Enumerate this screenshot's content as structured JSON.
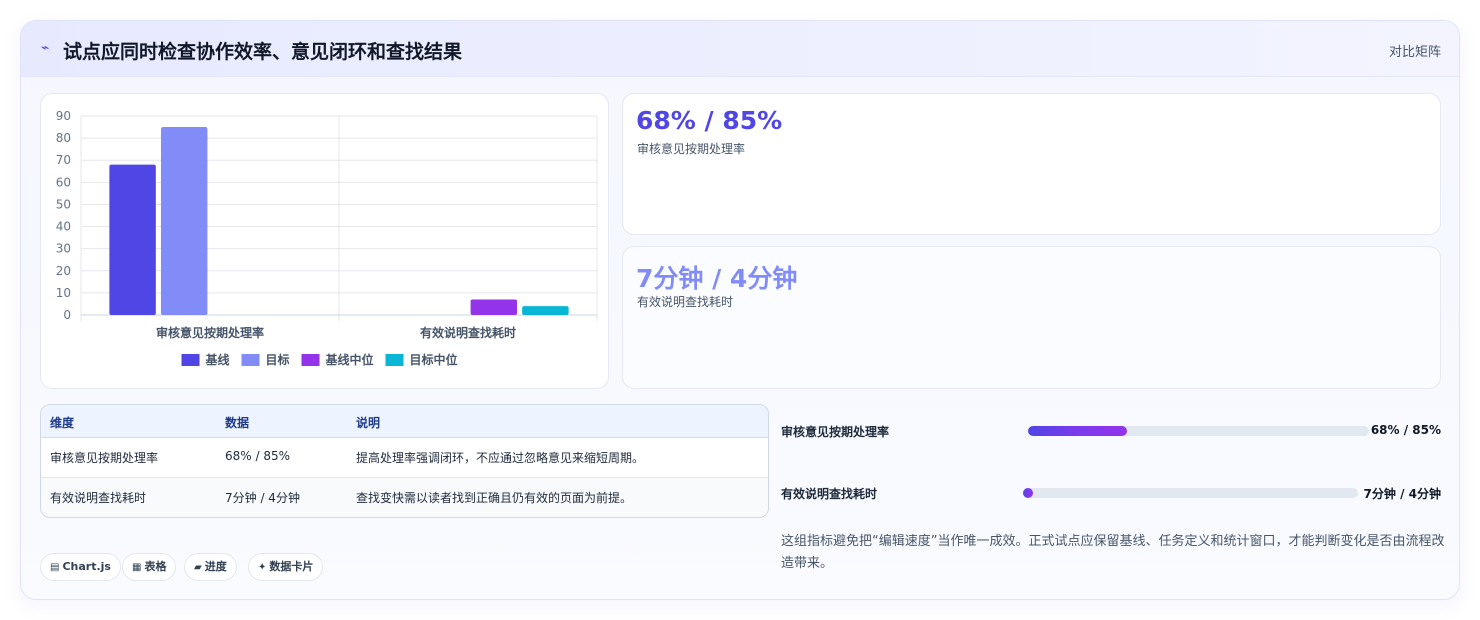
{
  "header": {
    "icon": "trend-icon",
    "title": "试点应同时检查协作效率、意见闭环和查找结果",
    "tag": "对比矩阵"
  },
  "chart_data": {
    "type": "bar",
    "categories": [
      "审核意见按期处理率",
      "有效说明查找耗时"
    ],
    "series": [
      {
        "name": "基线",
        "values": [
          68,
          null
        ],
        "color": "#4f46e5"
      },
      {
        "name": "目标",
        "values": [
          85,
          null
        ],
        "color": "#818cf8"
      },
      {
        "name": "基线中位",
        "values": [
          null,
          7
        ],
        "color": "#9333ea"
      },
      {
        "name": "目标中位",
        "values": [
          null,
          4
        ],
        "color": "#06b6d4"
      }
    ],
    "ylim": [
      0,
      90
    ],
    "yticks": [
      0,
      10,
      20,
      30,
      40,
      50,
      60,
      70,
      80,
      90
    ],
    "grid": true,
    "legend": "bottom",
    "xlabel": "",
    "ylabel": ""
  },
  "kpis": [
    {
      "value": "68% / 85%",
      "label": "审核意见按期处理率"
    },
    {
      "value": "7分钟 / 4分钟",
      "label": "有效说明查找耗时"
    }
  ],
  "table": {
    "headers": [
      "维度",
      "数据",
      "说明"
    ],
    "rows": [
      [
        "审核意见按期处理率",
        "68% / 85%",
        "提高处理率强调闭环，不应通过忽略意见来缩短周期。"
      ],
      [
        "有效说明查找耗时",
        "7分钟 / 4分钟",
        "查找变快需以读者找到正确且仍有效的页面为前提。"
      ]
    ]
  },
  "progress": [
    {
      "label": "审核意见按期处理率",
      "value": "68% / 85%",
      "fraction": 0.29
    },
    {
      "label": "有效说明查找耗时",
      "value": "7分钟 / 4分钟",
      "fraction": 0.02
    }
  ],
  "note": "这组指标避免把“编辑速度”当作唯一成效。正式试点应保留基线、任务定义和统计窗口，才能判断变化是否由流程改造带来。",
  "chips": [
    {
      "icon": "▤",
      "label": "Chart.js"
    },
    {
      "icon": "▦",
      "label": "表格"
    },
    {
      "icon": "▰",
      "label": "进度"
    },
    {
      "icon": "✦",
      "label": "数据卡片"
    }
  ]
}
